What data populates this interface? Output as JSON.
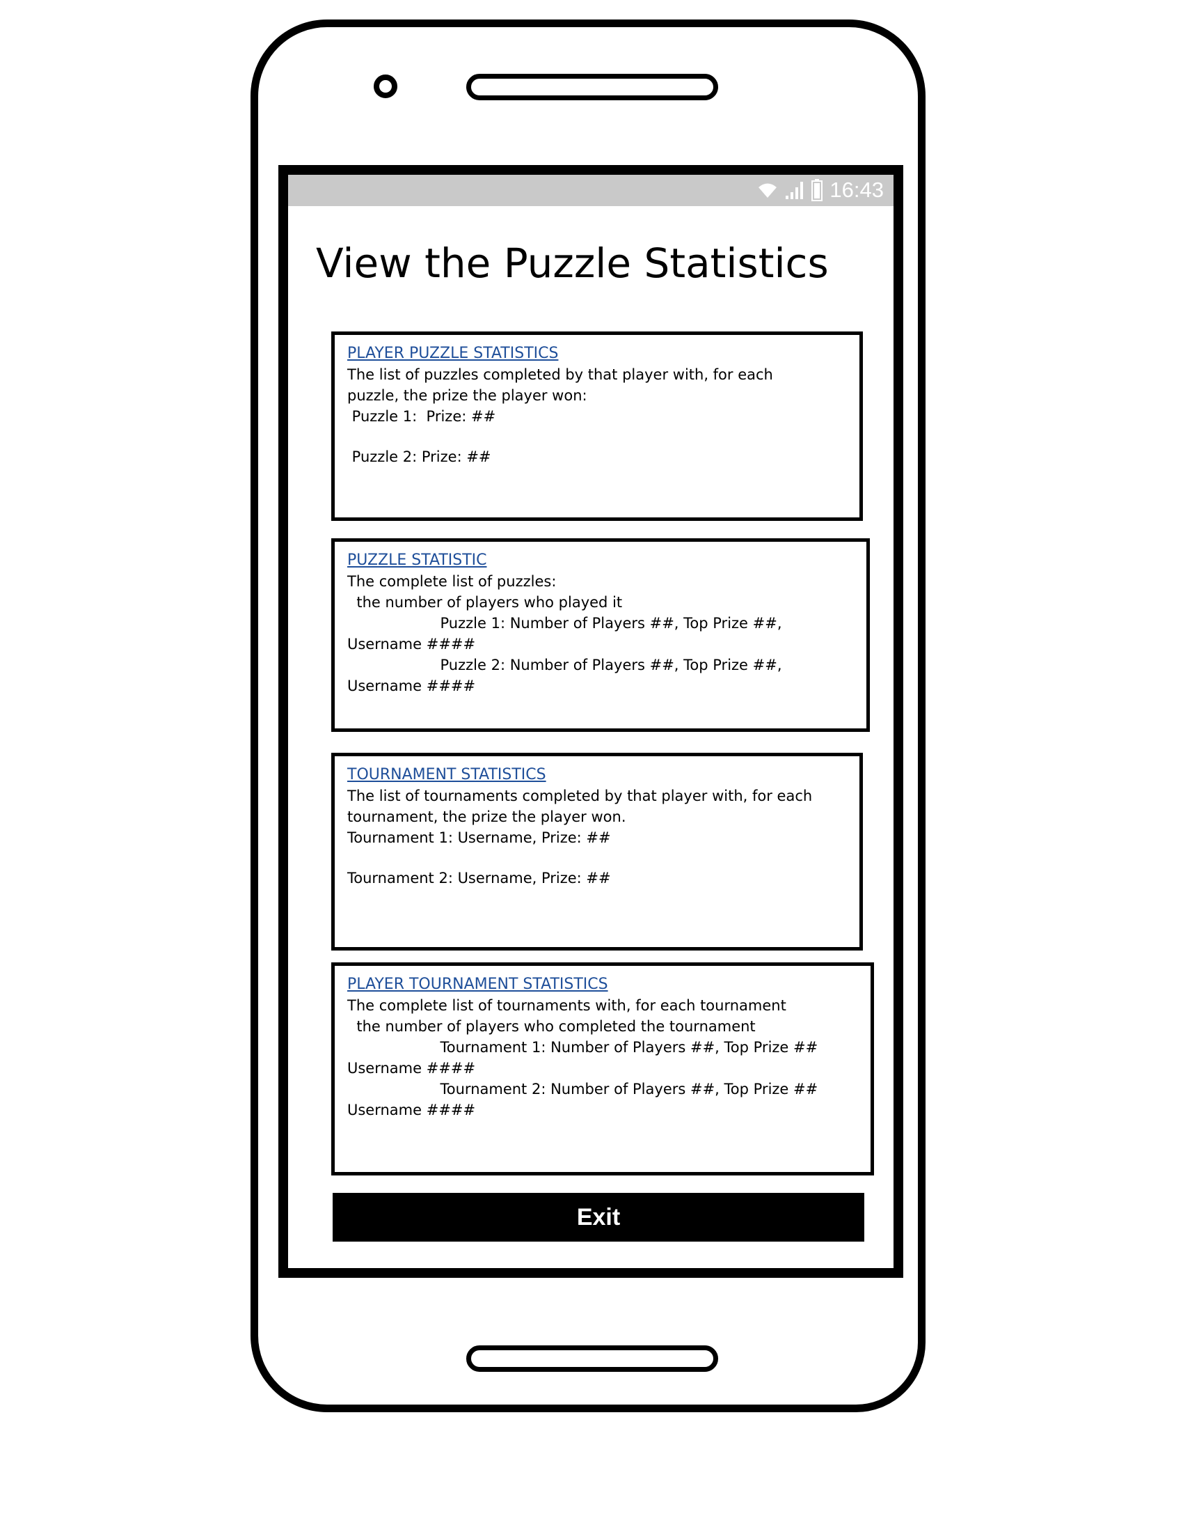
{
  "status_bar": {
    "time": "16:43",
    "icons": [
      "wifi-icon",
      "signal-icon",
      "battery-icon"
    ]
  },
  "title": "View the Puzzle Statistics",
  "cards": [
    {
      "title": "PLAYER PUZZLE STATISTICS",
      "lines": [
        "The list of puzzles completed by that player with, for each",
        "puzzle, the prize the player won:",
        " Puzzle 1:  Prize: ##",
        "",
        " Puzzle 2: Prize: ##"
      ]
    },
    {
      "title": "PUZZLE STATISTIC",
      "lines": [
        "The complete list of puzzles:",
        "  the number of players who played it",
        "                    Puzzle 1: Number of Players ##, Top Prize ##,",
        "Username ####",
        "                    Puzzle 2: Number of Players ##, Top Prize ##,",
        "Username ####"
      ]
    },
    {
      "title": "TOURNAMENT STATISTICS",
      "lines": [
        "The list of tournaments completed by that player with, for each",
        "tournament, the prize the player won.",
        "Tournament 1: Username, Prize: ##",
        "",
        "Tournament 2: Username, Prize: ##"
      ]
    },
    {
      "title": "PLAYER TOURNAMENT STATISTICS",
      "lines": [
        "The complete list of tournaments with, for each tournament",
        "  the number of players who completed the tournament",
        "                    Tournament 1: Number of Players ##, Top Prize ##",
        "Username ####",
        "                    Tournament 2: Number of Players ##, Top Prize ##",
        "Username ####"
      ]
    }
  ],
  "exit_button": {
    "label": "Exit"
  }
}
